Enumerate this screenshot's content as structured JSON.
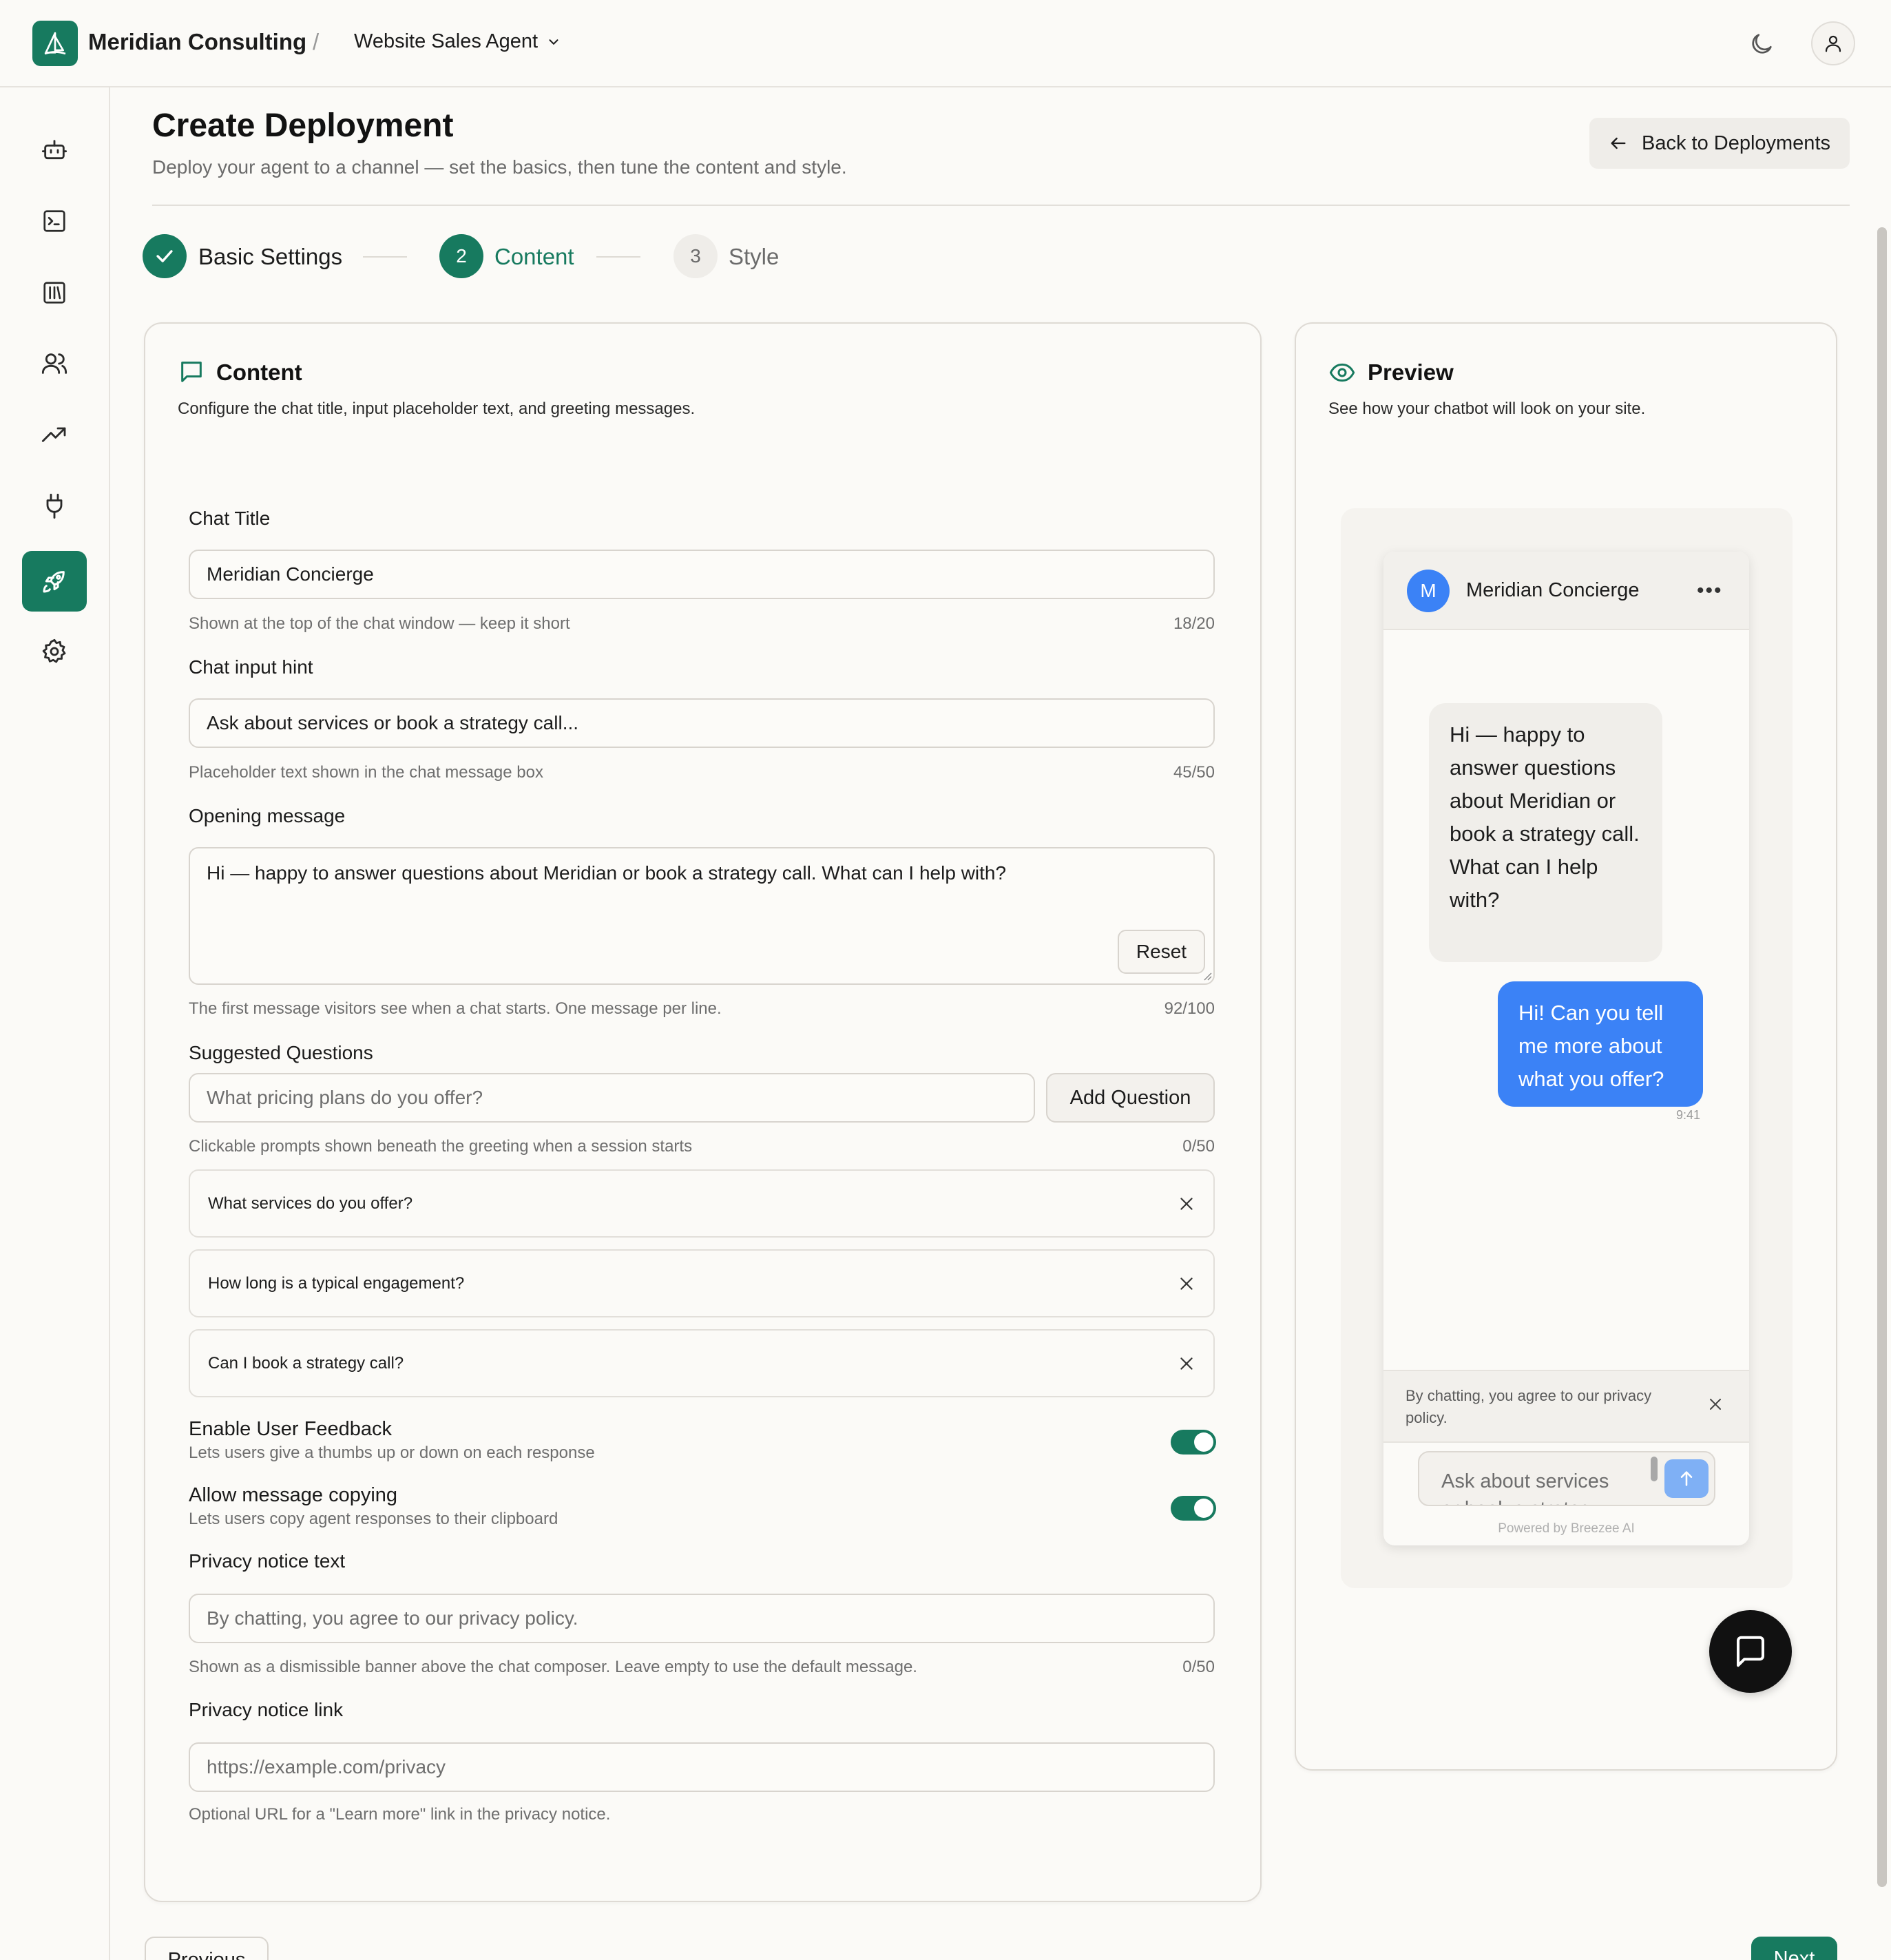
{
  "topbar": {
    "brand": "Meridian Consulting",
    "separator": "/",
    "agent": "Website Sales Agent"
  },
  "sidebar": {
    "items": [
      {
        "icon": "bot-icon"
      },
      {
        "icon": "terminal-icon"
      },
      {
        "icon": "library-icon"
      },
      {
        "icon": "users-icon"
      },
      {
        "icon": "trending-icon"
      },
      {
        "icon": "plug-icon"
      },
      {
        "icon": "rocket-icon",
        "active": true
      },
      {
        "icon": "gear-icon"
      }
    ]
  },
  "header": {
    "title": "Create Deployment",
    "subtitle": "Deploy your agent to a channel — set the basics, then tune the content and style.",
    "back_label": "Back to Deployments"
  },
  "stepper": {
    "steps": [
      {
        "number": "1",
        "label": "Basic Settings",
        "state": "done"
      },
      {
        "number": "2",
        "label": "Content",
        "state": "active"
      },
      {
        "number": "3",
        "label": "Style",
        "state": "upcoming"
      }
    ]
  },
  "content": {
    "title": "Content",
    "subtitle": "Configure the chat title, input placeholder text, and greeting messages.",
    "chat_title": {
      "label": "Chat Title",
      "value": "Meridian Concierge",
      "hint": "Shown at the top of the chat window — keep it short",
      "counter": "18/20"
    },
    "input_hint": {
      "label": "Chat input hint",
      "value": "Ask about services or book a strategy call...",
      "hint": "Placeholder text shown in the chat message box",
      "counter": "45/50"
    },
    "opening": {
      "label": "Opening message",
      "value": "Hi — happy to answer questions about Meridian or book a strategy call. What can I help with?",
      "reset_label": "Reset",
      "hint": "The first message visitors see when a chat starts. One message per line.",
      "counter": "92/100"
    },
    "suggested": {
      "label": "Suggested Questions",
      "placeholder": "What pricing plans do you offer?",
      "add_label": "Add Question",
      "hint": "Clickable prompts shown beneath the greeting when a session starts",
      "counter": "0/50",
      "items": [
        "What services do you offer?",
        "How long is a typical engagement?",
        "Can I book a strategy call?"
      ]
    },
    "feedback": {
      "title": "Enable User Feedback",
      "desc": "Lets users give a thumbs up or down on each response",
      "enabled": true
    },
    "copying": {
      "title": "Allow message copying",
      "desc": "Lets users copy agent responses to their clipboard",
      "enabled": true
    },
    "privacy_text": {
      "label": "Privacy notice text",
      "placeholder": "By chatting, you agree to our privacy policy.",
      "hint": "Shown as a dismissible banner above the chat composer. Leave empty to use the default message.",
      "counter": "0/50"
    },
    "privacy_link": {
      "label": "Privacy notice link",
      "placeholder": "https://example.com/privacy",
      "hint": "Optional URL for a \"Learn more\" link in the privacy notice."
    }
  },
  "preview": {
    "title": "Preview",
    "subtitle": "See how your chatbot will look on your site.",
    "avatar_letter": "M",
    "chat_title": "Meridian Concierge",
    "bot_message": "Hi — happy to answer questions about Meridian or book a strategy call. What can I help with?",
    "user_message": "Hi! Can you tell me more about what you offer?",
    "time": "9:41",
    "privacy": "By chatting, you agree to our privacy policy.",
    "composer_placeholder": "Ask about services or book a strategy...",
    "powered": "Powered by Breezee AI"
  },
  "footer": {
    "previous_label": "Previous",
    "next_label": "Next"
  },
  "colors": {
    "accent": "#177a5f",
    "user_bubble": "#3b82f6",
    "background": "#fbfaf7"
  }
}
